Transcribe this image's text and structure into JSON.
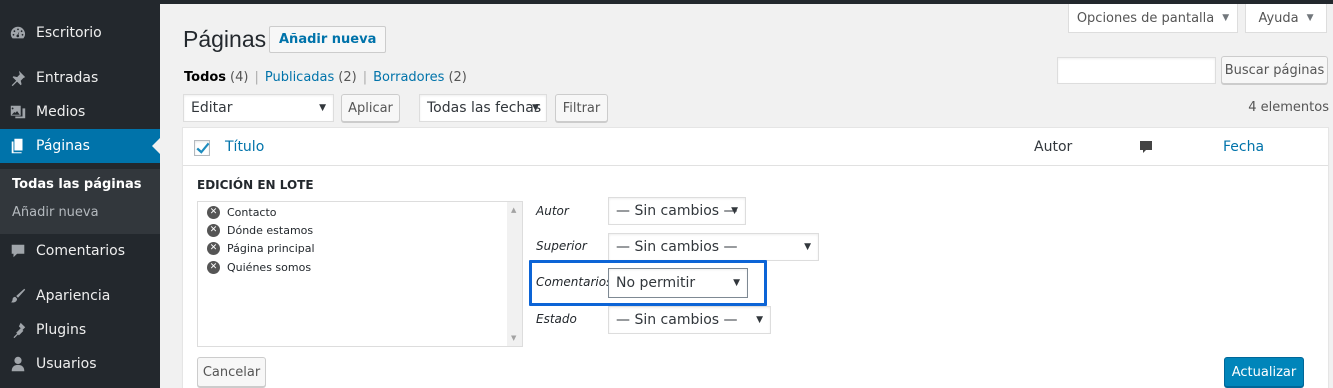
{
  "sidebar": {
    "items": [
      {
        "label": "Escritorio",
        "icon": "dashboard-icon"
      },
      {
        "label": "Entradas",
        "icon": "pin-icon"
      },
      {
        "label": "Medios",
        "icon": "media-icon"
      },
      {
        "label": "Páginas",
        "icon": "pages-icon"
      },
      {
        "label": "Comentarios",
        "icon": "comment-icon"
      },
      {
        "label": "Apariencia",
        "icon": "brush-icon"
      },
      {
        "label": "Plugins",
        "icon": "plugin-icon"
      },
      {
        "label": "Usuarios",
        "icon": "users-icon"
      }
    ],
    "submenu": [
      "Todas las páginas",
      "Añadir nueva"
    ]
  },
  "screen_meta": {
    "screen_options": "Opciones de pantalla",
    "help": "Ayuda"
  },
  "header": {
    "title": "Páginas",
    "add_new": "Añadir nueva"
  },
  "filters": {
    "views": [
      {
        "label": "Todos",
        "count": "(4)"
      },
      {
        "label": "Publicadas",
        "count": "(2)"
      },
      {
        "label": "Borradores",
        "count": "(2)"
      }
    ],
    "search_button": "Buscar páginas",
    "bulk_action": "Editar",
    "apply": "Aplicar",
    "dates": "Todas las fechas",
    "filter": "Filtrar",
    "items_count": "4 elementos"
  },
  "table": {
    "columns": {
      "title": "Título",
      "author": "Autor",
      "date": "Fecha"
    }
  },
  "bulk_edit": {
    "heading": "EDICIÓN EN LOTE",
    "pages": [
      "Contacto",
      "Dónde estamos",
      "Página principal",
      "Quiénes somos"
    ],
    "fields": [
      {
        "label": "Autor",
        "value": "— Sin cambios —"
      },
      {
        "label": "Superior",
        "value": "— Sin cambios —"
      },
      {
        "label": "Comentarios",
        "value": "No permitir"
      },
      {
        "label": "Estado",
        "value": "— Sin cambios —"
      }
    ],
    "cancel": "Cancelar",
    "update": "Actualizar"
  },
  "colors": {
    "sidebar_bg": "#23282d",
    "accent": "#0073aa",
    "highlight_border": "#0c64d6",
    "primary_button": "#0085ba"
  }
}
